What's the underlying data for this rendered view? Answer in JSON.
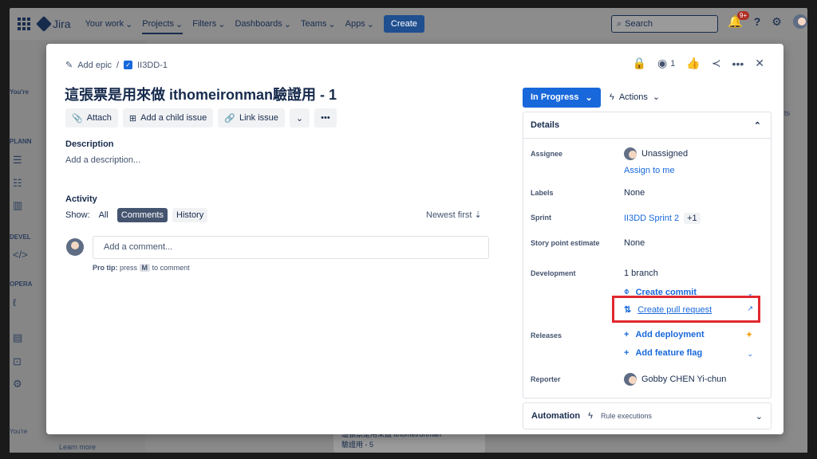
{
  "topnav": {
    "app_name": "Jira",
    "items": [
      "Your work",
      "Projects",
      "Filters",
      "Dashboards",
      "Teams",
      "Apps"
    ],
    "create_label": "Create",
    "search_placeholder": "Search",
    "notification_count": "9+"
  },
  "sidebar": {
    "labels": [
      "PLANN",
      "DEVEL",
      "OPERA"
    ],
    "you_re": "You're",
    "footer": "You're",
    "learn_more": "Learn more"
  },
  "background": {
    "card_text_1": "這張票是用來做 ithomeironman",
    "card_text_2": "驗證用 - 5",
    "right_text": "ts"
  },
  "issue": {
    "breadcrumb_epic": "Add epic",
    "breadcrumb_sep": "/",
    "issue_key": "II3DD-1",
    "watch_count": "1",
    "title": "這張票是用來做 ithomeironman驗證用 - 1",
    "toolbar": {
      "attach": "Attach",
      "child": "Add a child issue",
      "link": "Link issue",
      "more": "•••"
    },
    "description_label": "Description",
    "description_placeholder": "Add a description...",
    "activity_label": "Activity",
    "show_label": "Show:",
    "filters": [
      "All",
      "Comments",
      "History"
    ],
    "sort_label": "Newest first",
    "comment_placeholder": "Add a comment...",
    "protip_prefix": "Pro tip:",
    "protip_press": "press",
    "protip_key": "M",
    "protip_suffix": "to comment"
  },
  "panel": {
    "status": "In Progress",
    "actions": "Actions",
    "details_title": "Details",
    "assignee_label": "Assignee",
    "assignee_value": "Unassigned",
    "assign_to_me": "Assign to me",
    "labels_label": "Labels",
    "labels_value": "None",
    "sprint_label": "Sprint",
    "sprint_value": "II3DD Sprint 2",
    "sprint_extra": "+1",
    "story_label": "Story point estimate",
    "story_value": "None",
    "dev_label": "Development",
    "dev_branch": "1 branch",
    "create_commit": "Create commit",
    "create_pr": "Create pull request",
    "releases_label": "Releases",
    "add_deployment": "Add deployment",
    "add_feature_flag": "Add feature flag",
    "reporter_label": "Reporter",
    "reporter_value": "Gobby CHEN Yi-chun",
    "automation_title": "Automation",
    "automation_sub": "Rule executions"
  }
}
